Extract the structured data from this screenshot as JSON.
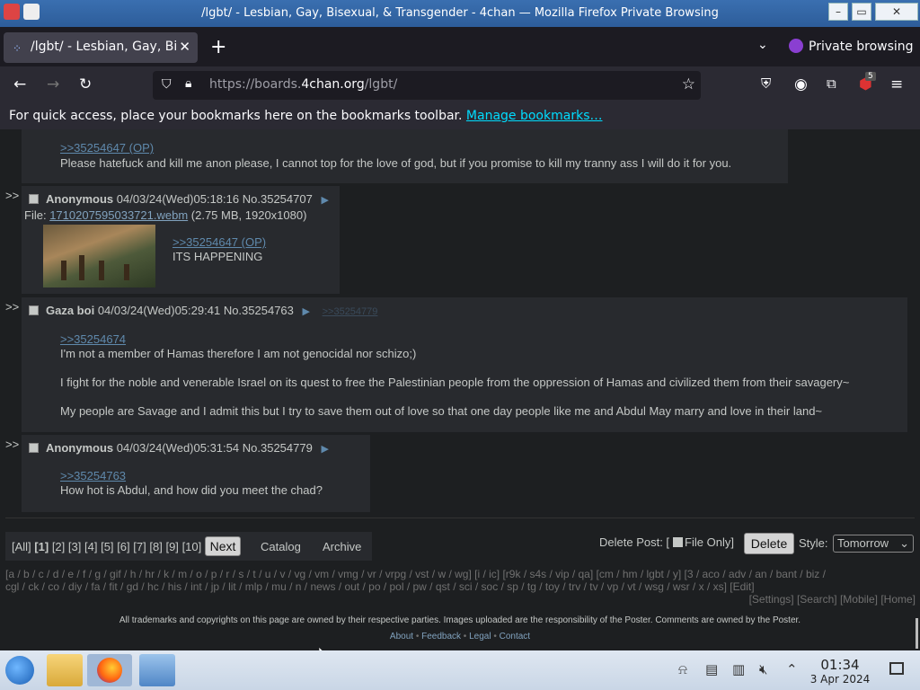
{
  "window": {
    "title": "/lgbt/ - Lesbian, Gay, Bisexual, & Transgender - 4chan — Mozilla Firefox Private Browsing",
    "controls": [
      "–",
      "▭",
      "✕"
    ]
  },
  "tabs": {
    "active_label": "/lgbt/ - Lesbian, Gay, Bisexual, & Transgender - 4chan",
    "close": "✕",
    "new_tab": "+",
    "list": "⌄",
    "private_label": "Private browsing"
  },
  "nav": {
    "back": "←",
    "forward": "→",
    "reload": "↻",
    "url_prefix": "https://boards.",
    "url_domain": "4chan.org",
    "url_path": "/lgbt/",
    "bookmark_star": "☆",
    "extension_badge": "5"
  },
  "bookmarks_bar": {
    "text": "For quick access, place your bookmarks here on the bookmarks toolbar.",
    "link": "Manage bookmarks…"
  },
  "posts": [
    {
      "quote": ">>35254647 (OP)",
      "message": "Please hatefuck and kill me anon please, I cannot top for the love of god, but if you promise to kill my tranny ass I will do it for you."
    },
    {
      "arrow": ">>",
      "name": "Anonymous",
      "datetime": "04/03/24(Wed)05:18:16",
      "number": "No.35254707",
      "menu": "▶",
      "file_label": "File:",
      "file_name": "1710207595033721.webm",
      "file_info": "(2.75 MB, 1920x1080)",
      "quote": ">>35254647 (OP)",
      "message": "ITS HAPPENING"
    },
    {
      "arrow": ">>",
      "name": "Gaza boi",
      "datetime": "04/03/24(Wed)05:29:41",
      "number": "No.35254763",
      "menu": "▶",
      "backlink": ">>35254779",
      "quote": ">>35254674",
      "lines": [
        "I'm not a member of Hamas therefore I am not genocidal nor schizo;)",
        "I fight for the noble and venerable Israel on its quest to free the Palestinian people from the oppression of Hamas and civilized them from their savagery~",
        "My people are Savage and I admit this but I try to save them out of love so that one day people like me and Abdul May marry and love in their land~"
      ]
    },
    {
      "arrow": ">>",
      "name": "Anonymous",
      "datetime": "04/03/24(Wed)05:31:54",
      "number": "No.35254779",
      "menu": "▶",
      "quote": ">>35254763",
      "message": "How hot is Abdul, and how did you meet the chad?"
    }
  ],
  "pagination": {
    "all": "[All]",
    "pages": [
      "[1]",
      "[2]",
      "[3]",
      "[4]",
      "[5]",
      "[6]",
      "[7]",
      "[8]",
      "[9]",
      "[10]"
    ],
    "next": "Next",
    "catalog": "Catalog",
    "archive": "Archive"
  },
  "delete_form": {
    "label": "Delete Post: [",
    "file_only": "File Only]",
    "button": "Delete",
    "style_label": "Style:",
    "style_value": "Tomorrow"
  },
  "boardlist": {
    "line1": "[a / b / c / d / e / f / g / gif / h / hr / k / m / o / p / r / s / t / u / v / vg / vm / vmg / vr / vrpg / vst / w / wg] [i / ic] [r9k / s4s / vip / qa] [cm / hm / lgbt / y] [3 / aco / adv / an / bant / biz /",
    "line2": "cgl / ck / co / diy / fa / fit / gd / hc / his / int / jp / lit / mlp / mu / n / news / out / po / pol / pw / qst / sci / soc / sp / tg / toy / trv / tv / vp / vt / wsg / wsr / x / xs] [Edit]",
    "right": "[Settings] [Search] [Mobile] [Home]"
  },
  "footer": {
    "disclaimer": "All trademarks and copyrights on this page are owned by their respective parties. Images uploaded are the responsibility of the Poster. Comments are owned by the Poster.",
    "links": [
      "About",
      "Feedback",
      "Legal",
      "Contact"
    ],
    "sep": " • "
  },
  "taskbar": {
    "time": "01:34",
    "date": "3 Apr 2024"
  }
}
